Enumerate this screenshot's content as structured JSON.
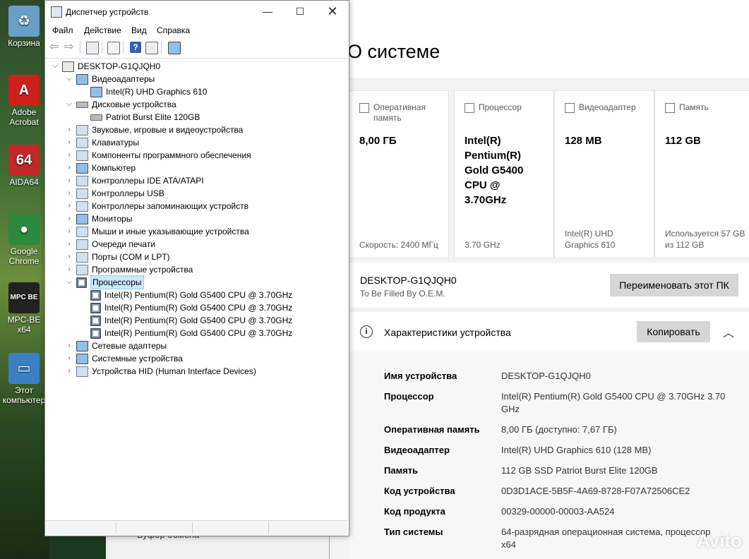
{
  "desktop": {
    "icons": [
      {
        "label": "Корзина",
        "name": "recycle-bin-icon",
        "color": "#6aa0c8",
        "glyph": "♻"
      },
      {
        "label": "Adobe Acrobat",
        "name": "adobe-acrobat-icon",
        "color": "#d0201b",
        "glyph": "A"
      },
      {
        "label": "AIDA64",
        "name": "aida64-icon",
        "color": "#c0282a",
        "glyph": "64"
      },
      {
        "label": "Google Chrome",
        "name": "chrome-icon",
        "color": "#2b8a3e",
        "glyph": "●"
      },
      {
        "label": "MPC-BE x64",
        "name": "mpc-be-icon",
        "color": "#222222",
        "glyph": "MPC BE"
      },
      {
        "label": "Этот компьютер",
        "name": "this-pc-icon",
        "color": "#3d7fc4",
        "glyph": "▭"
      }
    ]
  },
  "devmgr": {
    "title": "Диспетчер устройств",
    "menu": [
      "Файл",
      "Действие",
      "Вид",
      "Справка"
    ],
    "root": "DESKTOP-G1QJQH0",
    "tree": [
      {
        "label": "Видеоадаптеры",
        "expanded": true,
        "level": 1,
        "icon": "monitor"
      },
      {
        "label": "Intel(R) UHD Graphics 610",
        "level": 2,
        "icon": "monitor"
      },
      {
        "label": "Дисковые устройства",
        "expanded": true,
        "level": 1,
        "icon": "disk"
      },
      {
        "label": "Patriot Burst Elite 120GB",
        "level": 2,
        "icon": "disk"
      },
      {
        "label": "Звуковые, игровые и видеоустройства",
        "level": 1,
        "icon": "generic"
      },
      {
        "label": "Клавиатуры",
        "level": 1,
        "icon": "generic"
      },
      {
        "label": "Компоненты программного обеспечения",
        "level": 1,
        "icon": "generic"
      },
      {
        "label": "Компьютер",
        "level": 1,
        "icon": "monitor"
      },
      {
        "label": "Контроллеры IDE ATA/ATAPI",
        "level": 1,
        "icon": "generic"
      },
      {
        "label": "Контроллеры USB",
        "level": 1,
        "icon": "generic"
      },
      {
        "label": "Контроллеры запоминающих устройств",
        "level": 1,
        "icon": "generic"
      },
      {
        "label": "Мониторы",
        "level": 1,
        "icon": "monitor"
      },
      {
        "label": "Мыши и иные указывающие устройства",
        "level": 1,
        "icon": "generic"
      },
      {
        "label": "Очереди печати",
        "level": 1,
        "icon": "generic"
      },
      {
        "label": "Порты (COM и LPT)",
        "level": 1,
        "icon": "generic"
      },
      {
        "label": "Программные устройства",
        "level": 1,
        "icon": "generic"
      },
      {
        "label": "Процессоры",
        "expanded": true,
        "level": 1,
        "icon": "cpu",
        "selected": true
      },
      {
        "label": "Intel(R) Pentium(R) Gold G5400 CPU @ 3.70GHz",
        "level": 2,
        "icon": "cpu"
      },
      {
        "label": "Intel(R) Pentium(R) Gold G5400 CPU @ 3.70GHz",
        "level": 2,
        "icon": "cpu"
      },
      {
        "label": "Intel(R) Pentium(R) Gold G5400 CPU @ 3.70GHz",
        "level": 2,
        "icon": "cpu"
      },
      {
        "label": "Intel(R) Pentium(R) Gold G5400 CPU @ 3.70GHz",
        "level": 2,
        "icon": "cpu"
      },
      {
        "label": "Сетевые адаптеры",
        "level": 1,
        "icon": "monitor"
      },
      {
        "label": "Системные устройства",
        "level": 1,
        "icon": "monitor"
      },
      {
        "label": "Устройства HID (Human Interface Devices)",
        "level": 1,
        "icon": "generic"
      }
    ],
    "behind_text": "Буфер обмена"
  },
  "settings": {
    "title": "О системе",
    "cards": [
      {
        "header": "Оперативная память",
        "value": "8,00 ГБ",
        "sub": "Скорость: 2400 МГц"
      },
      {
        "header": "Процессор",
        "value": "Intel(R) Pentium(R) Gold G5400 CPU @ 3.70GHz",
        "sub": "3.70 GHz"
      },
      {
        "header": "Видеоадаптер",
        "value": "128 MB",
        "sub": "Intel(R) UHD Graphics 610"
      },
      {
        "header": "Память",
        "value": "112 GB",
        "sub": "Используется 57 GB из 112 GB"
      }
    ],
    "pc_name": "DESKTOP-G1QJQH0",
    "pc_sub": "To Be Filled By O.E.M.",
    "rename_label": "Переименовать этот ПК",
    "specs_title": "Характеристики устройства",
    "copy_label": "Копировать",
    "specs": [
      {
        "k": "Имя устройства",
        "v": "DESKTOP-G1QJQH0"
      },
      {
        "k": "Процессор",
        "v": "Intel(R) Pentium(R) Gold G5400 CPU @ 3.70GHz 3.70 GHz"
      },
      {
        "k": "Оперативная память",
        "v": "8,00 ГБ (доступно: 7,67 ГБ)"
      },
      {
        "k": "Видеоадаптер",
        "v": "Intel(R) UHD Graphics 610 (128 MB)"
      },
      {
        "k": "Память",
        "v": "112 GB SSD Patriot Burst Elite 120GB"
      },
      {
        "k": "Код устройства",
        "v": "0D3D1ACE-5B5F-4A69-8728-F07A72506CE2"
      },
      {
        "k": "Код продукта",
        "v": "00329-00000-00003-AA524"
      },
      {
        "k": "Тип системы",
        "v": "64-разрядная операционная система, процессор x64"
      }
    ],
    "watermark": "Avito"
  }
}
